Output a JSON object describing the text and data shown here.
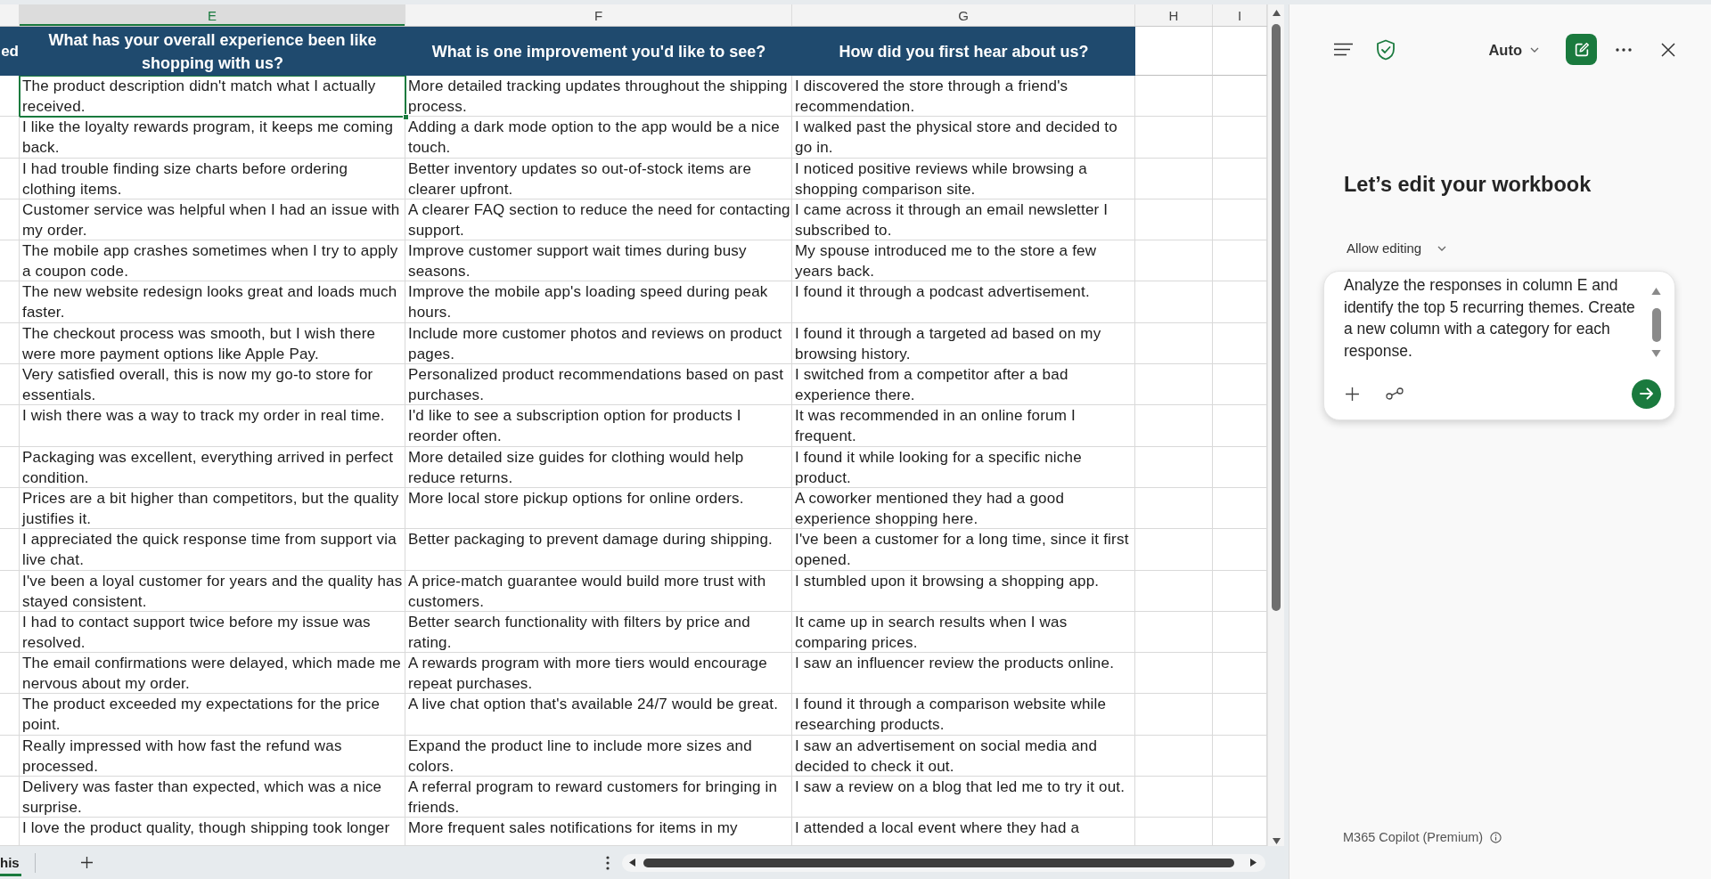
{
  "sheet": {
    "columns": [
      {
        "kind": "cut",
        "header": "ed"
      },
      {
        "kind": "question",
        "letter": "E",
        "header": "What has your overall experience been like shopping with us?"
      },
      {
        "kind": "question",
        "letter": "F",
        "header": "What is one improvement you'd like to see?"
      },
      {
        "kind": "question",
        "letter": "G",
        "header": "How did you first hear about us?"
      },
      {
        "kind": "blank",
        "letter": "H"
      },
      {
        "kind": "blank",
        "letter": "I"
      }
    ],
    "rows": [
      {
        "cells": [
          {
            "text": "",
            "selected": false
          },
          {
            "text": "The product description didn't match what I actually received.",
            "selected": true
          },
          {
            "text": "More detailed tracking updates throughout the shipping process.",
            "selected": false
          },
          {
            "text": "I discovered the store through a friend's recommendation.",
            "selected": false
          },
          {
            "text": "",
            "selected": false
          },
          {
            "text": "",
            "selected": false
          }
        ]
      },
      {
        "cells": [
          {
            "text": "",
            "selected": false
          },
          {
            "text": "I like the loyalty rewards program, it keeps me coming back.",
            "selected": false
          },
          {
            "text": "Adding a dark mode option to the app would be a nice touch.",
            "selected": false
          },
          {
            "text": "I walked past the physical store and decided to go in.",
            "selected": false
          },
          {
            "text": "",
            "selected": false
          },
          {
            "text": "",
            "selected": false
          }
        ]
      },
      {
        "cells": [
          {
            "text": "",
            "selected": false
          },
          {
            "text": "I had trouble finding size charts before ordering clothing items.",
            "selected": false
          },
          {
            "text": "Better inventory updates so out-of-stock items are clearer upfront.",
            "selected": false
          },
          {
            "text": "I noticed positive reviews while browsing a shopping comparison site.",
            "selected": false
          },
          {
            "text": "",
            "selected": false
          },
          {
            "text": "",
            "selected": false
          }
        ]
      },
      {
        "cells": [
          {
            "text": "",
            "selected": false
          },
          {
            "text": "Customer service was helpful when I had an issue with my order.",
            "selected": false
          },
          {
            "text": "A clearer FAQ section to reduce the need for contacting support.",
            "selected": false
          },
          {
            "text": "I came across it through an email newsletter I subscribed to.",
            "selected": false
          },
          {
            "text": "",
            "selected": false
          },
          {
            "text": "",
            "selected": false
          }
        ]
      },
      {
        "cells": [
          {
            "text": "",
            "selected": false
          },
          {
            "text": "The mobile app crashes sometimes when I try to apply a coupon code.",
            "selected": false
          },
          {
            "text": "Improve customer support wait times during busy seasons.",
            "selected": false
          },
          {
            "text": "My spouse introduced me to the store a few years back.",
            "selected": false
          },
          {
            "text": "",
            "selected": false
          },
          {
            "text": "",
            "selected": false
          }
        ]
      },
      {
        "cells": [
          {
            "text": "",
            "selected": false
          },
          {
            "text": "The new website redesign looks great and loads much faster.",
            "selected": false
          },
          {
            "text": "Improve the mobile app's loading speed during peak hours.",
            "selected": false
          },
          {
            "text": "I found it through a podcast advertisement.",
            "selected": false
          },
          {
            "text": "",
            "selected": false
          },
          {
            "text": "",
            "selected": false
          }
        ]
      },
      {
        "cells": [
          {
            "text": "",
            "selected": false
          },
          {
            "text": "The checkout process was smooth, but I wish there were more payment options like Apple Pay.",
            "selected": false
          },
          {
            "text": "Include more customer photos and reviews on product pages.",
            "selected": false
          },
          {
            "text": "I found it through a targeted ad based on my browsing history.",
            "selected": false
          },
          {
            "text": "",
            "selected": false
          },
          {
            "text": "",
            "selected": false
          }
        ]
      },
      {
        "cells": [
          {
            "text": "",
            "selected": false
          },
          {
            "text": "Very satisfied overall, this is now my go-to store for essentials.",
            "selected": false
          },
          {
            "text": "Personalized product recommendations based on past purchases.",
            "selected": false
          },
          {
            "text": "I switched from a competitor after a bad experience there.",
            "selected": false
          },
          {
            "text": "",
            "selected": false
          },
          {
            "text": "",
            "selected": false
          }
        ]
      },
      {
        "cells": [
          {
            "text": "",
            "selected": false
          },
          {
            "text": "I wish there was a way to track my order in real time.",
            "selected": false
          },
          {
            "text": "I'd like to see a subscription option for products I reorder often.",
            "selected": false
          },
          {
            "text": "It was recommended in an online forum I frequent.",
            "selected": false
          },
          {
            "text": "",
            "selected": false
          },
          {
            "text": "",
            "selected": false
          }
        ]
      },
      {
        "cells": [
          {
            "text": "",
            "selected": false
          },
          {
            "text": "Packaging was excellent, everything arrived in perfect condition.",
            "selected": false
          },
          {
            "text": "More detailed size guides for clothing would help reduce returns.",
            "selected": false
          },
          {
            "text": "I found it while looking for a specific niche product.",
            "selected": false
          },
          {
            "text": "",
            "selected": false
          },
          {
            "text": "",
            "selected": false
          }
        ]
      },
      {
        "cells": [
          {
            "text": "",
            "selected": false
          },
          {
            "text": "Prices are a bit higher than competitors, but the quality justifies it.",
            "selected": false
          },
          {
            "text": "More local store pickup options for online orders.",
            "selected": false
          },
          {
            "text": "A coworker mentioned they had a good experience shopping here.",
            "selected": false
          },
          {
            "text": "",
            "selected": false
          },
          {
            "text": "",
            "selected": false
          }
        ]
      },
      {
        "cells": [
          {
            "text": "",
            "selected": false
          },
          {
            "text": "I appreciated the quick response time from support via live chat.",
            "selected": false
          },
          {
            "text": "Better packaging to prevent damage during shipping.",
            "selected": false
          },
          {
            "text": "I've been a customer for a long time, since it first opened.",
            "selected": false
          },
          {
            "text": "",
            "selected": false
          },
          {
            "text": "",
            "selected": false
          }
        ]
      },
      {
        "cells": [
          {
            "text": "",
            "selected": false
          },
          {
            "text": "I've been a loyal customer for years and the quality has stayed consistent.",
            "selected": false
          },
          {
            "text": "A price-match guarantee would build more trust with customers.",
            "selected": false
          },
          {
            "text": "I stumbled upon it browsing a shopping app.",
            "selected": false
          },
          {
            "text": "",
            "selected": false
          },
          {
            "text": "",
            "selected": false
          }
        ]
      },
      {
        "cells": [
          {
            "text": "",
            "selected": false
          },
          {
            "text": "I had to contact support twice before my issue was resolved.",
            "selected": false
          },
          {
            "text": "Better search functionality with filters by price and rating.",
            "selected": false
          },
          {
            "text": "It came up in search results when I was comparing prices.",
            "selected": false
          },
          {
            "text": "",
            "selected": false
          },
          {
            "text": "",
            "selected": false
          }
        ]
      },
      {
        "cells": [
          {
            "text": "",
            "selected": false
          },
          {
            "text": "The email confirmations were delayed, which made me nervous about my order.",
            "selected": false
          },
          {
            "text": "A rewards program with more tiers would encourage repeat purchases.",
            "selected": false
          },
          {
            "text": "I saw an influencer review the products online.",
            "selected": false
          },
          {
            "text": "",
            "selected": false
          },
          {
            "text": "",
            "selected": false
          }
        ]
      },
      {
        "cells": [
          {
            "text": "",
            "selected": false
          },
          {
            "text": "The product exceeded my expectations for the price point.",
            "selected": false
          },
          {
            "text": "A live chat option that's available 24/7 would be great.",
            "selected": false
          },
          {
            "text": "I found it through a comparison website while researching products.",
            "selected": false
          },
          {
            "text": "",
            "selected": false
          },
          {
            "text": "",
            "selected": false
          }
        ]
      },
      {
        "cells": [
          {
            "text": "",
            "selected": false
          },
          {
            "text": "Really impressed with how fast the refund was processed.",
            "selected": false
          },
          {
            "text": "Expand the product line to include more sizes and colors.",
            "selected": false
          },
          {
            "text": "I saw an advertisement on social media and decided to check it out.",
            "selected": false
          },
          {
            "text": "",
            "selected": false
          },
          {
            "text": "",
            "selected": false
          }
        ]
      },
      {
        "cells": [
          {
            "text": "",
            "selected": false
          },
          {
            "text": "Delivery was faster than expected, which was a nice surprise.",
            "selected": false
          },
          {
            "text": "A referral program to reward customers for bringing in friends.",
            "selected": false
          },
          {
            "text": "I saw a review on a blog that led me to try it out.",
            "selected": false
          },
          {
            "text": "",
            "selected": false
          },
          {
            "text": "",
            "selected": false
          }
        ]
      },
      {
        "cells": [
          {
            "text": "",
            "selected": false
          },
          {
            "text": "I love the product quality, though shipping took longer",
            "selected": false
          },
          {
            "text": "More frequent sales notifications for items in my",
            "selected": false
          },
          {
            "text": "I attended a local event where they had a",
            "selected": false
          },
          {
            "text": "",
            "selected": false
          },
          {
            "text": "",
            "selected": false
          }
        ]
      }
    ],
    "sheet_tabs": [
      {
        "label": "his",
        "selected": true
      }
    ]
  },
  "copilot_panel": {
    "mode_dropdown": {
      "label": "Auto"
    },
    "heading": "Let’s edit your workbook",
    "permission_dropdown": {
      "label": "Allow editing"
    },
    "prompt": {
      "value": "Analyze the responses in column E and identify the top 5 recurring themes. Create a new column with a category for each response."
    },
    "footer": "M365 Copilot (Premium)"
  }
}
